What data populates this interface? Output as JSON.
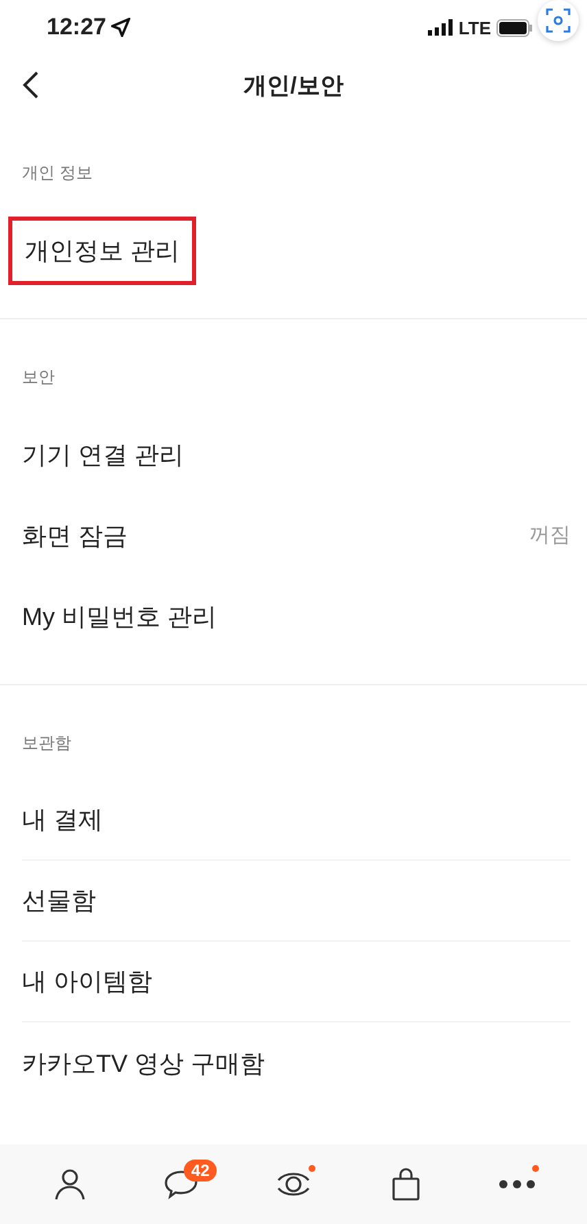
{
  "status_bar": {
    "time": "12:27",
    "network": "LTE"
  },
  "header": {
    "title": "개인/보안"
  },
  "sections": [
    {
      "label": "개인 정보",
      "separated": false,
      "items": [
        {
          "label": "개인정보 관리",
          "highlighted": true
        }
      ]
    },
    {
      "label": "보안",
      "separated": false,
      "items": [
        {
          "label": "기기 연결 관리",
          "highlighted": false
        },
        {
          "label": "화면 잠금",
          "value": "꺼짐",
          "highlighted": false
        },
        {
          "label": "My 비밀번호 관리",
          "highlighted": false
        }
      ]
    },
    {
      "label": "보관함",
      "separated": true,
      "items": [
        {
          "label": "내 결제",
          "highlighted": false
        },
        {
          "label": "선물함",
          "highlighted": false
        },
        {
          "label": "내 아이템함",
          "highlighted": false
        },
        {
          "label": "카카오TV 영상 구매함",
          "highlighted": false
        }
      ]
    }
  ],
  "tab_bar": [
    {
      "kind": "friends",
      "dot": false
    },
    {
      "kind": "chats",
      "badge": "42",
      "dot": false
    },
    {
      "kind": "view",
      "dot": true
    },
    {
      "kind": "shopping",
      "dot": false
    },
    {
      "kind": "more",
      "dot": true
    }
  ]
}
